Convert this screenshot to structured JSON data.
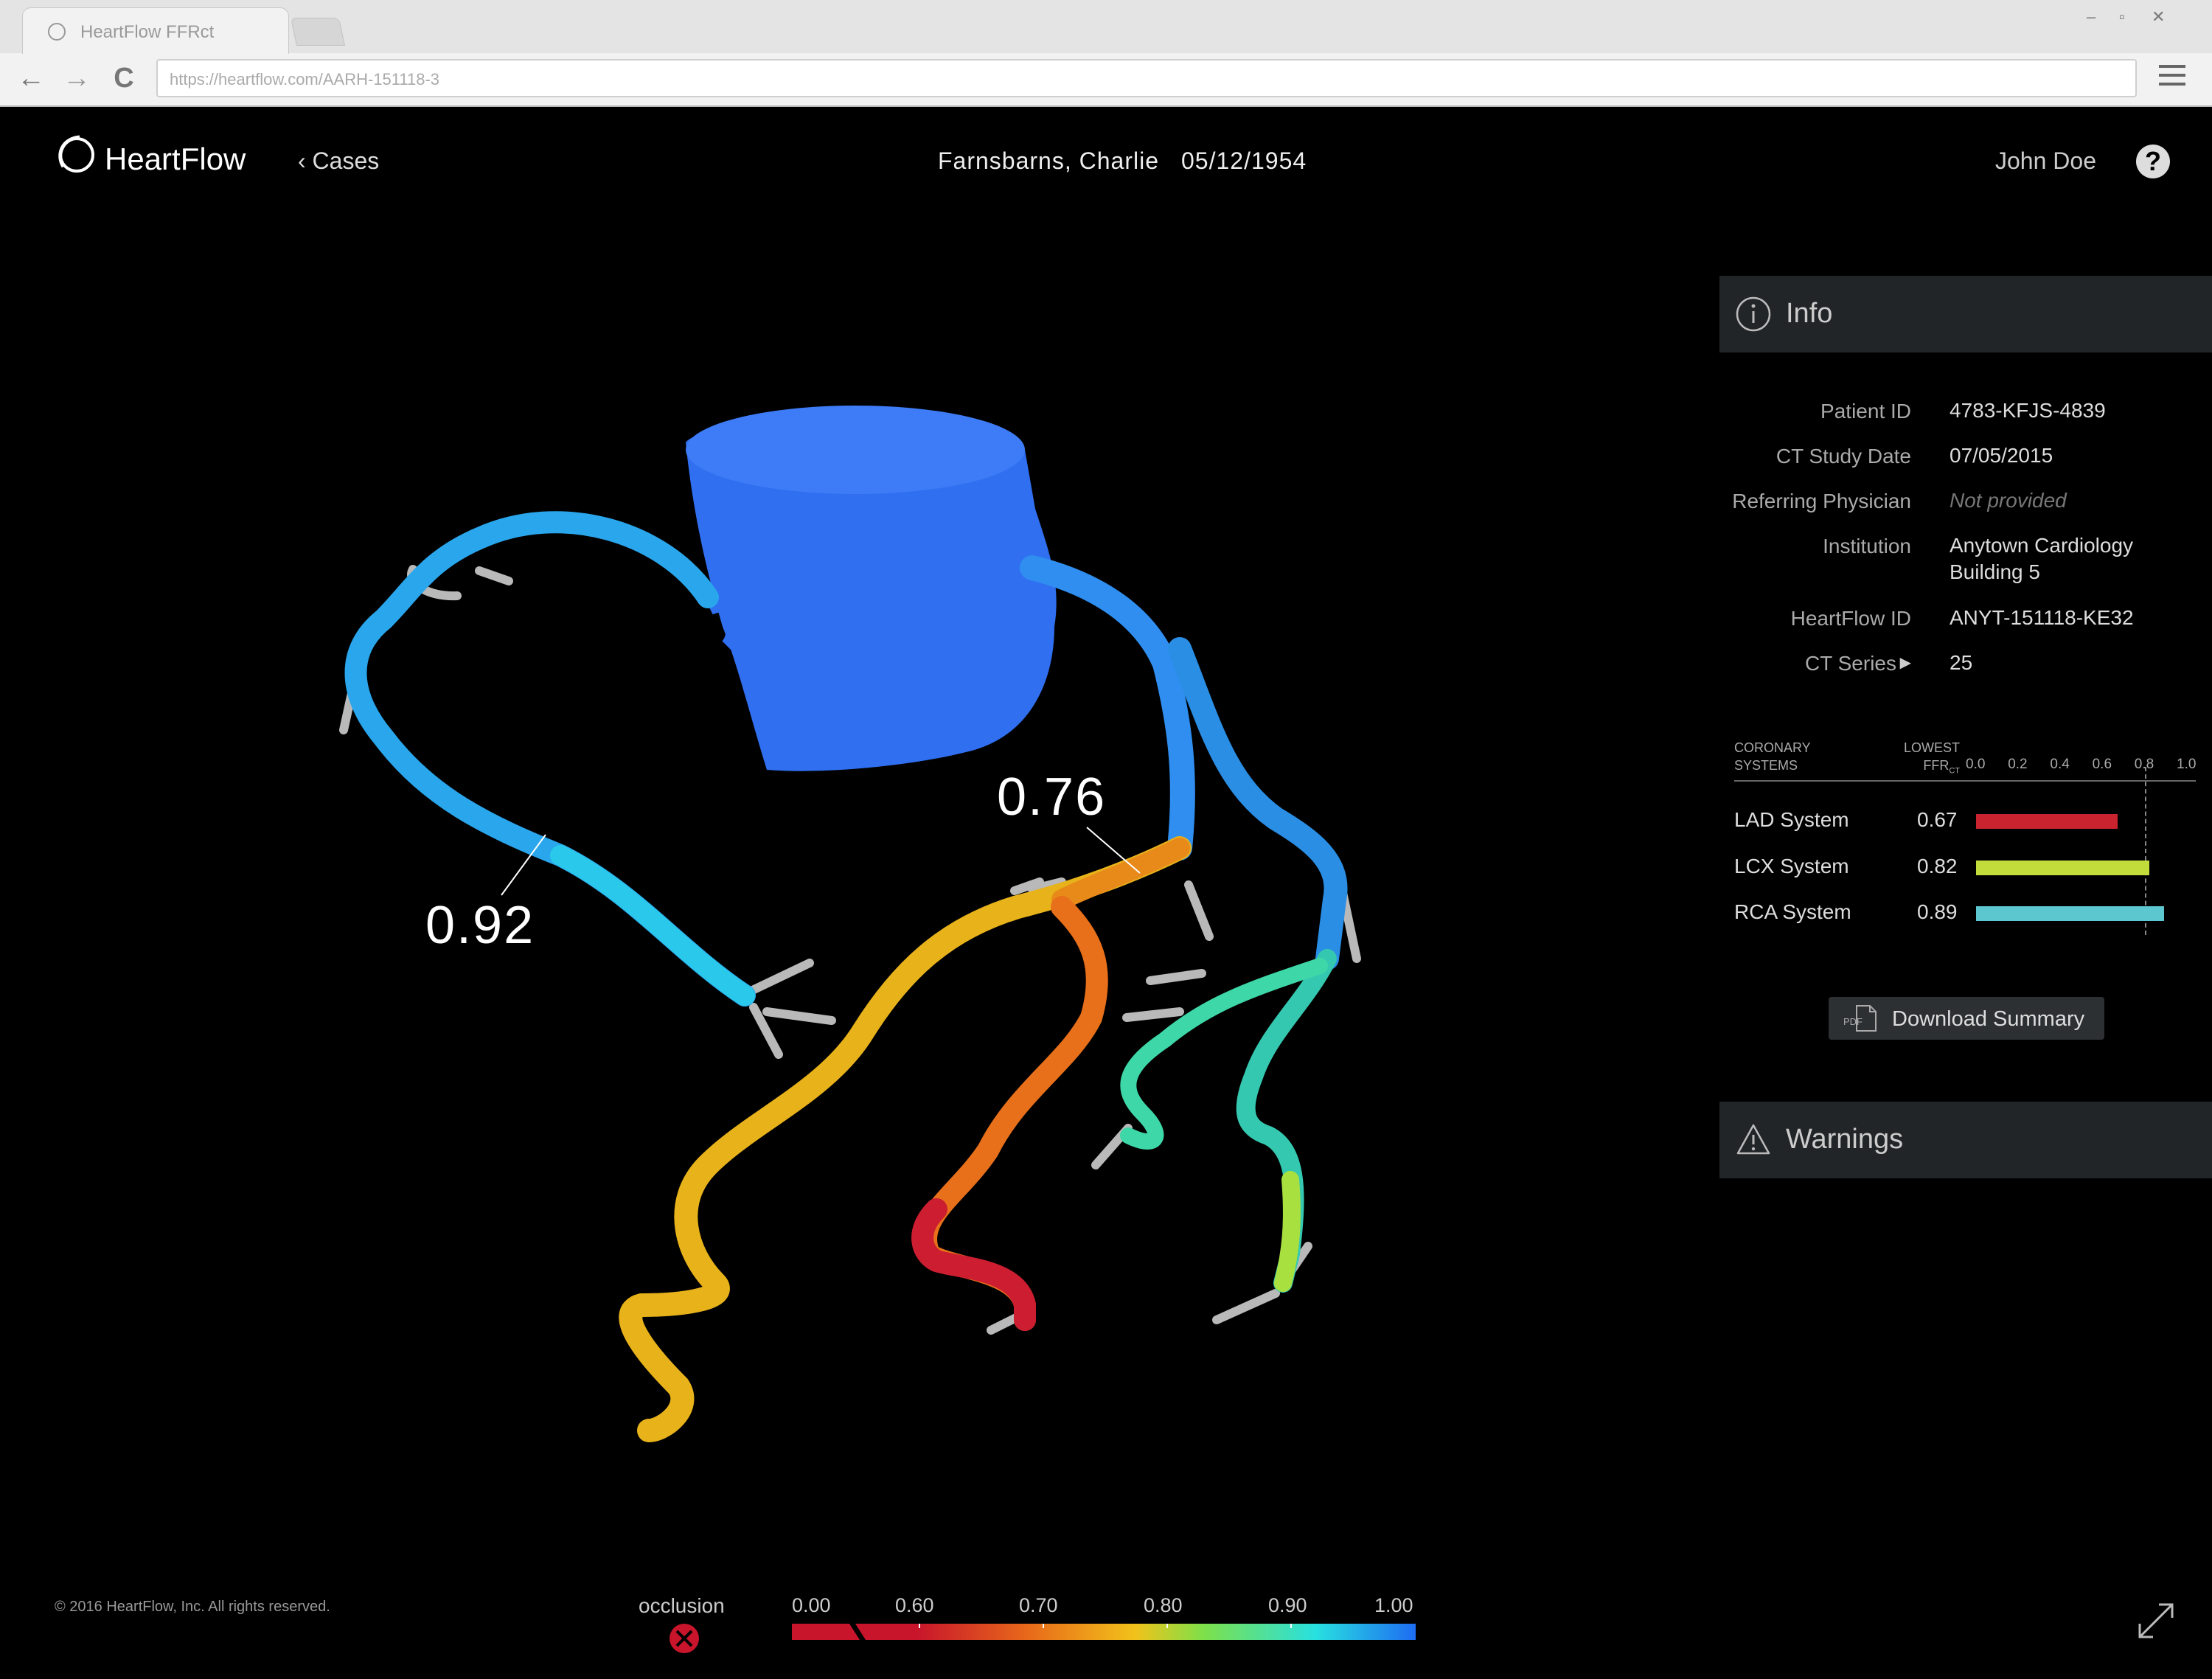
{
  "browser": {
    "tab_title": "HeartFlow FFRct",
    "url": "https://heartflow.com/AARH-151118-3",
    "window_controls": {
      "minimize": "–",
      "maximize": "▫",
      "close": "✕"
    },
    "nav": {
      "back": "←",
      "forward": "→",
      "reload": "C"
    }
  },
  "header": {
    "logo_text": "HeartFlow",
    "back_link": "Cases",
    "patient_name": "Farnsbarns, Charlie",
    "patient_dob": "05/12/1954",
    "user_name": "John Doe",
    "help_label": "?"
  },
  "viewer": {
    "annotations": [
      {
        "value": "0.92"
      },
      {
        "value": "0.76"
      }
    ],
    "colors": {
      "aorta": "#2f6ff0",
      "rca": "#29a6ec",
      "lad": "#e8b21a",
      "lcx": "#2aa0d8",
      "stub": "#b9b9b9"
    }
  },
  "info_panel": {
    "title": "Info",
    "rows": [
      {
        "label": "Patient ID",
        "value": "4783-KFJS-4839"
      },
      {
        "label": "CT Study Date",
        "value": "07/05/2015"
      },
      {
        "label": "Referring Physician",
        "value": "Not provided"
      },
      {
        "label": "Institution",
        "value": "Anytown Cardiology",
        "value2": "Building 5"
      },
      {
        "label": "HeartFlow ID",
        "value": "ANYT-151118-KE32"
      },
      {
        "label": "CT  Series",
        "value": "25"
      }
    ],
    "systems_header": {
      "left_1": "CORONARY",
      "left_2": "SYSTEMS",
      "right_1": "LOWEST",
      "right_2": "FFR",
      "right_sub": "CT"
    },
    "scale_ticks": [
      "0.0",
      "0.2",
      "0.4",
      "0.6",
      "0.8",
      "1.0"
    ],
    "threshold": 0.8,
    "systems": [
      {
        "name": "LAD System",
        "value": "0.67",
        "ffr": 0.67,
        "color": "#c8232f"
      },
      {
        "name": "LCX System",
        "value": "0.82",
        "ffr": 0.82,
        "color": "#c2dc3c"
      },
      {
        "name": "RCA System",
        "value": "0.89",
        "ffr": 0.89,
        "color": "#5cc7cf"
      }
    ],
    "download_label": "Download Summary",
    "pdf_label": "PDF"
  },
  "warnings_panel": {
    "title": "Warnings"
  },
  "footer": {
    "copyright": "© 2016 HeartFlow, Inc.  All rights reserved.",
    "occlusion_label": "occlusion",
    "legend_ticks": [
      "0.00",
      "0.60",
      "0.70",
      "0.80",
      "0.90",
      "1.00"
    ],
    "legend_colors": [
      "#c8152c",
      "#c8152c",
      "#e86a1a",
      "#f2c21a",
      "#7ee04a",
      "#28e0e0",
      "#1e6cf2"
    ]
  }
}
